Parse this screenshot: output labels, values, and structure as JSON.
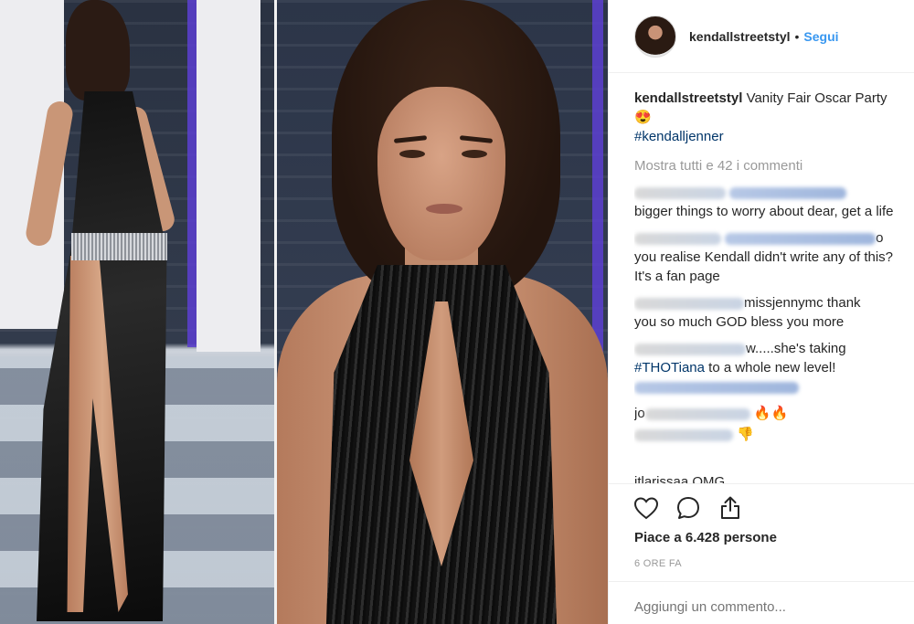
{
  "post": {
    "username": "kendallstreetstyl",
    "follow_separator": "•",
    "follow_label": "Segui",
    "caption_user": "kendallstreetstyl",
    "caption_text": "Vanity Fair Oscar Party",
    "caption_emoji": "😍",
    "caption_hashtag": "#kendalljenner",
    "view_all_label": "Mostra tutti e 42 i commenti",
    "likes_label": "Piace a 6.428 persone",
    "time_label": "6 ORE FA",
    "add_comment_placeholder": "Aggiungi un commento..."
  },
  "comments": [
    {
      "text": "bigger things to worry about dear, get a life"
    },
    {
      "suffix": "o",
      "text": "you realise Kendall didn't write any of this? It's a fan page"
    },
    {
      "text_inline": "missjennymc thank",
      "text": "you so much GOD bless you more"
    },
    {
      "text_inline": "w.....she's taking",
      "hashtag": "#THOTiana",
      "text": " to a whole new level!"
    },
    {
      "prefix": "jo",
      "emoji": "🔥🔥"
    },
    {
      "emoji": "👎"
    },
    {
      "user": "itlarissaa",
      "text": "OMG"
    }
  ],
  "colors": {
    "link_blue": "#3897f0",
    "hashtag": "#003569",
    "muted": "#999999",
    "text": "#262626"
  },
  "icons": [
    "heart-icon",
    "comment-icon",
    "share-icon"
  ]
}
